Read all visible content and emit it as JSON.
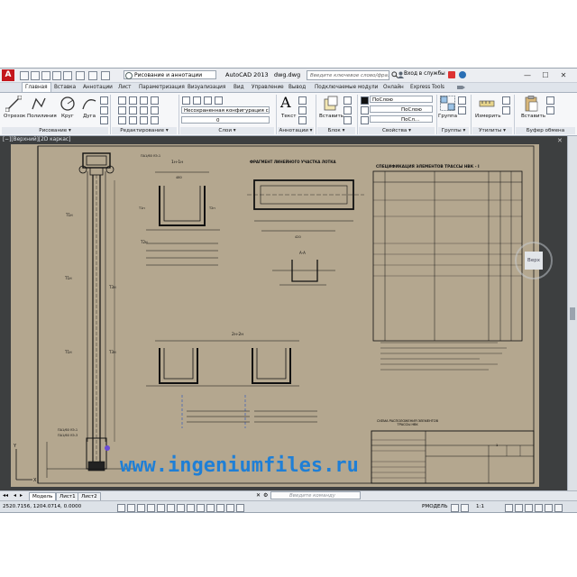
{
  "app": {
    "title": "AutoCAD 2013",
    "filename": "dwg.dwg",
    "logo_letter": "A",
    "workspace": "Рисование и аннотации",
    "search_placeholder": "Введите ключевое слово/фразу",
    "signin": "Вход в службы",
    "window_buttons": [
      "—",
      "☐",
      "✕"
    ]
  },
  "ribbon": {
    "tabs": [
      "Главная",
      "Вставка",
      "Аннотации",
      "Лист",
      "Параметризация",
      "Визуализация",
      "Вид",
      "Управление",
      "Вывод",
      "Подключаемые модули",
      "Онлайн",
      "Express Tools"
    ],
    "active_tab": "Главная",
    "draw_tools": [
      "Отрезок",
      "Полилиния",
      "Круг",
      "Дуга"
    ],
    "panels": [
      "Рисование",
      "Редактирование",
      "Слои",
      "Аннотации",
      "Блок",
      "Свойства",
      "Группы",
      "Утилиты",
      "Буфер обмена"
    ],
    "layer_state": "Несохраненная конфигурация слоя",
    "layer_current": "0",
    "annotation_tool": "Текст",
    "block_tool": "Вставить",
    "color_value": "ПоСлою",
    "linetype_value": "ПоСлою",
    "lineweight_value": "ПоСл...",
    "groups_tool": "Группа",
    "utility_tool": "Измерить",
    "clipboard_tool": "Вставить"
  },
  "viewport": {
    "label": "[−][Верхний][2D каркас]",
    "viewcube_label": "Верх",
    "background_color": "#3d3f40",
    "paper_color": "#b4a78f"
  },
  "drawing": {
    "spec_title": "СПЕЦИФИКАЦИЯ ЭЛЕМЕНТОВ ТРАССЫ НВК - I",
    "fragment_title": "ФРАГМЕНТ ЛИНЕЙНОГО УЧАСТКА ЛОТКА",
    "section_1": "1н-1н",
    "section_2": "2н-2н",
    "section_a": "А-А",
    "stamp_name": "СХЕМА РАСПОЛОЖЕНИЯ ЭЛЕМЕНТОВ ТРАССЫ НВК",
    "stamp_sheet": "1"
  },
  "watermark": "www.ingeniumfiles.ru",
  "bottom_tabs": [
    "Модель",
    "Лист1",
    "Лист2"
  ],
  "active_bottom_tab": "Модель",
  "command_placeholder": "Введите команду",
  "status": {
    "coords": "2520.7156, 1204.0714, 0.0000",
    "mode": "РМОДЕЛЬ",
    "scale": "1:1"
  }
}
